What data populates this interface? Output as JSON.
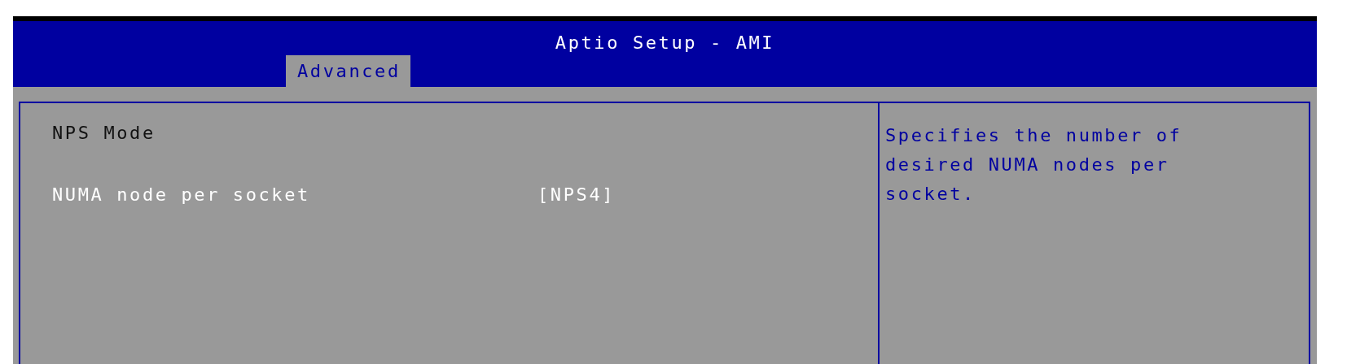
{
  "window": {
    "title": "Aptio Setup - AMI"
  },
  "tabs": [
    {
      "label": "Advanced",
      "selected": true
    }
  ],
  "settings": [
    {
      "kind": "heading",
      "label": "NPS Mode"
    },
    {
      "kind": "option",
      "label": "NUMA node per socket",
      "value": "[NPS4]"
    }
  ],
  "help": {
    "text": "Specifies the number of desired NUMA nodes per socket."
  }
}
